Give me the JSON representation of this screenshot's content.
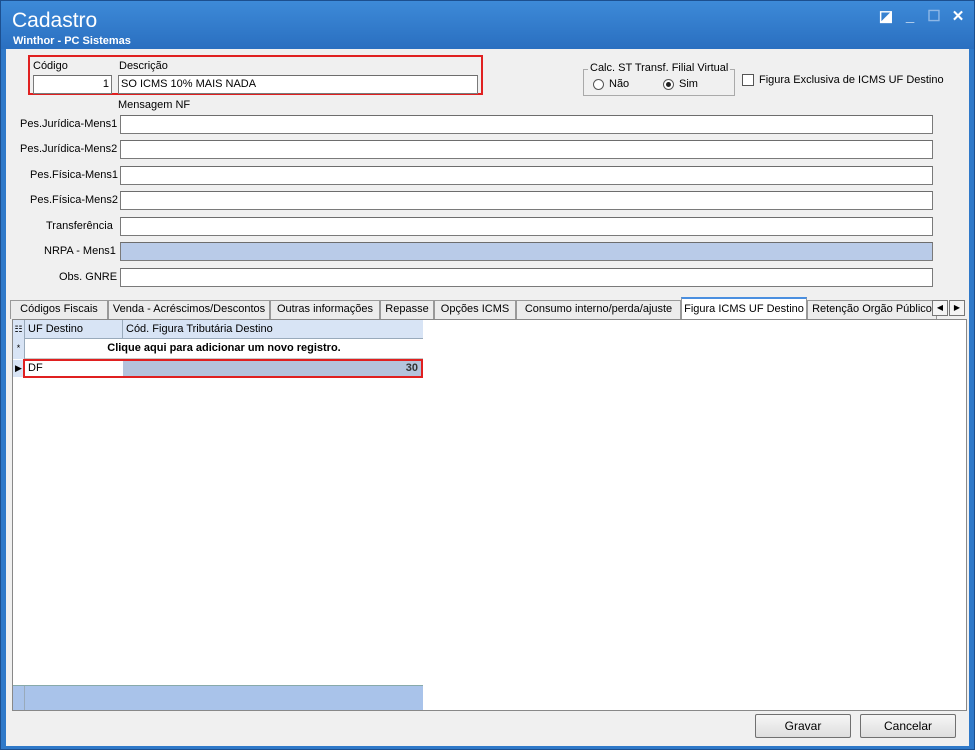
{
  "window": {
    "title": "Cadastro",
    "subtitle": "Winthor - PC Sistemas"
  },
  "form": {
    "codigo_label": "Código",
    "codigo_value": "1",
    "descricao_label": "Descrição",
    "descricao_value": "SO ICMS 10% MAIS NADA",
    "calc_st_title": "Calc. ST Transf. Filial Virtual",
    "radio_nao": "Não",
    "radio_sim": "Sim",
    "calc_st_selected": "Sim",
    "figura_exclusiva_label": "Figura Exclusiva de ICMS UF Destino",
    "figura_exclusiva_checked": false,
    "mensagem_nf_label": "Mensagem NF",
    "fields": [
      {
        "label": "Pes.Jurídica-Mens1",
        "value": ""
      },
      {
        "label": "Pes.Jurídica-Mens2",
        "value": ""
      },
      {
        "label": "Pes.Física-Mens1",
        "value": ""
      },
      {
        "label": "Pes.Física-Mens2",
        "value": ""
      },
      {
        "label": "Transferência",
        "value": ""
      },
      {
        "label": "NRPA - Mens1",
        "value": ""
      },
      {
        "label": "Obs. GNRE",
        "value": ""
      }
    ]
  },
  "tabs": [
    {
      "label": "Códigos Fiscais"
    },
    {
      "label": "Venda - Acréscimos/Descontos"
    },
    {
      "label": "Outras informações"
    },
    {
      "label": "Repasse"
    },
    {
      "label": "Opções ICMS"
    },
    {
      "label": "Consumo interno/perda/ajuste"
    },
    {
      "label": "Figura ICMS UF Destino"
    },
    {
      "label": "Retenção Orgão Público"
    }
  ],
  "active_tab": "Figura ICMS UF Destino",
  "grid": {
    "columns": [
      "UF Destino",
      "Cód. Figura Tributária Destino"
    ],
    "new_row_text": "Clique aqui para adicionar um novo registro.",
    "rows": [
      {
        "uf": "DF",
        "cod": "30"
      }
    ]
  },
  "buttons": {
    "gravar_label": "Gravar",
    "cancelar_label": "Cancelar"
  },
  "colors": {
    "title_bar": "#2f79c9",
    "highlight_red": "#e02020",
    "grid_header": "#d8e4f5",
    "grid_footer": "#a9c3ea",
    "active_tab_accent": "#4a8fe0"
  }
}
